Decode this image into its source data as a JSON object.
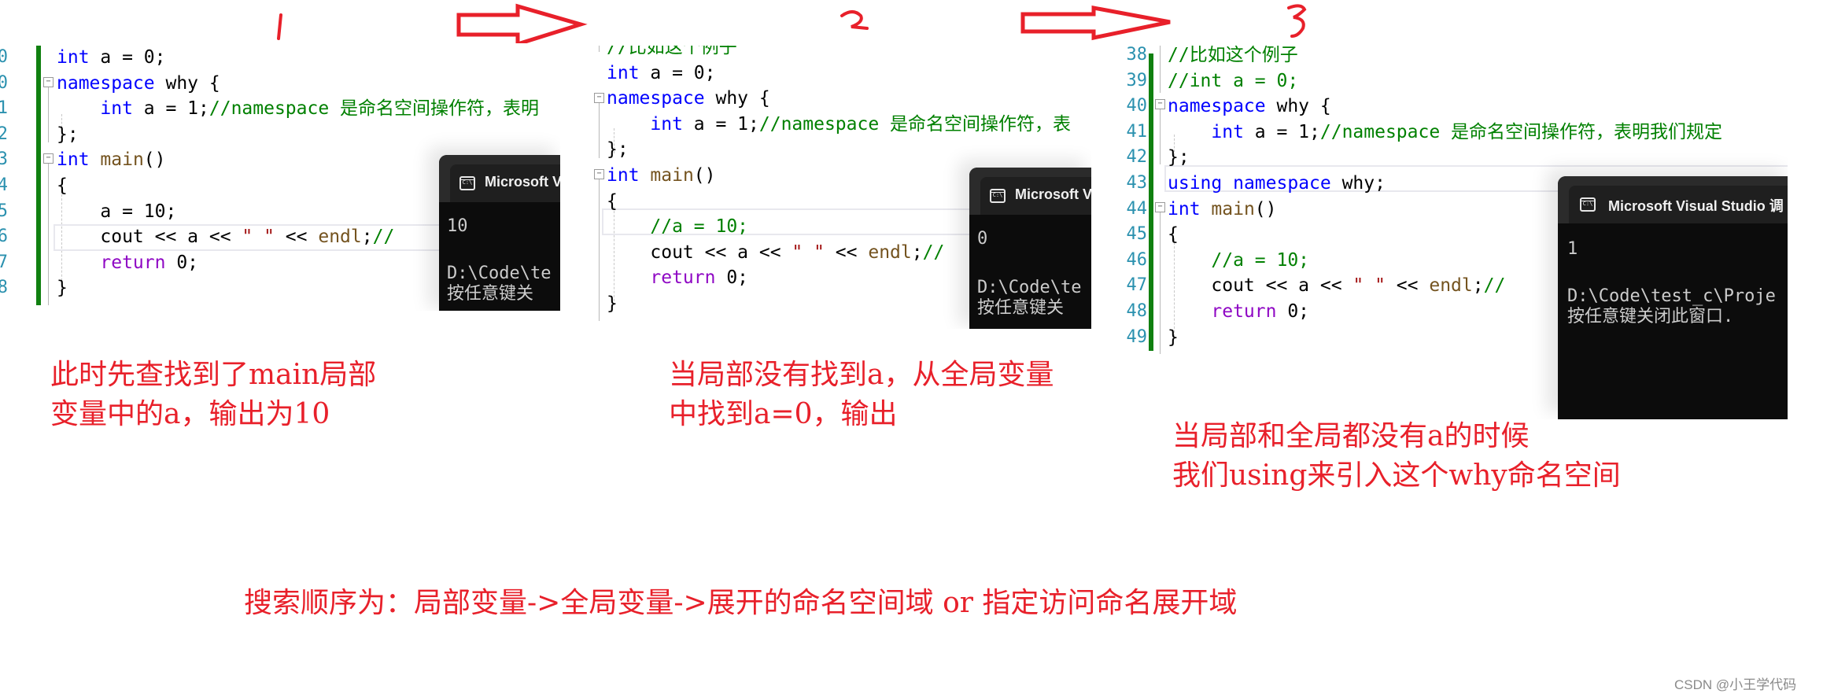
{
  "step_markers": [
    "1",
    "2",
    "3"
  ],
  "panels": [
    {
      "id": "panel-1",
      "line_numbers": [
        "0",
        "0",
        "1",
        "2",
        "3",
        "4",
        "5",
        "6",
        "7",
        "8"
      ],
      "lines": [
        [
          {
            "t": "int",
            "c": "kw"
          },
          {
            "t": " a = 0;",
            "c": "tx"
          }
        ],
        [
          {
            "t": "namespace",
            "c": "kw"
          },
          {
            "t": " why {",
            "c": "tx"
          }
        ],
        [
          {
            "t": "    ",
            "c": "tx"
          },
          {
            "t": "int",
            "c": "kw"
          },
          {
            "t": " a = 1;",
            "c": "tx"
          },
          {
            "t": "//namespace 是命名空间操作符，表明",
            "c": "cm"
          }
        ],
        [
          {
            "t": "};",
            "c": "tx"
          }
        ],
        [
          {
            "t": "int",
            "c": "kw"
          },
          {
            "t": " ",
            "c": "tx"
          },
          {
            "t": "main",
            "c": "fn"
          },
          {
            "t": "()",
            "c": "tx"
          }
        ],
        [
          {
            "t": "{",
            "c": "tx"
          }
        ],
        [
          {
            "t": "    a = 10;",
            "c": "tx"
          }
        ],
        [
          {
            "t": "    cout << a << ",
            "c": "tx"
          },
          {
            "t": "\" \"",
            "c": "st"
          },
          {
            "t": " << ",
            "c": "tx"
          },
          {
            "t": "endl",
            "c": "fn"
          },
          {
            "t": ";",
            "c": "tx"
          },
          {
            "t": "//",
            "c": "cm"
          }
        ],
        [
          {
            "t": "    ",
            "c": "tx"
          },
          {
            "t": "return",
            "c": "kw2"
          },
          {
            "t": " 0;",
            "c": "tx"
          }
        ],
        [
          {
            "t": "}",
            "c": "tx"
          }
        ]
      ],
      "console": {
        "title": "Microsoft V",
        "icon": "console-window-icon",
        "output": "10",
        "path": "D:\\Code\\te",
        "prompt": "按任意键关"
      },
      "caption": [
        "此时先查找到了main局部",
        "变量中的a，输出为10"
      ]
    },
    {
      "id": "panel-2",
      "lines": [
        [
          {
            "t": "//比如这个例子",
            "c": "cm"
          }
        ],
        [
          {
            "t": "int",
            "c": "kw"
          },
          {
            "t": " a = 0;",
            "c": "tx"
          }
        ],
        [
          {
            "t": "namespace",
            "c": "kw"
          },
          {
            "t": " why {",
            "c": "tx"
          }
        ],
        [
          {
            "t": "    ",
            "c": "tx"
          },
          {
            "t": "int",
            "c": "kw"
          },
          {
            "t": " a = 1;",
            "c": "tx"
          },
          {
            "t": "//namespace 是命名空间操作符，表",
            "c": "cm"
          }
        ],
        [
          {
            "t": "};",
            "c": "tx"
          }
        ],
        [
          {
            "t": "int",
            "c": "kw"
          },
          {
            "t": " ",
            "c": "tx"
          },
          {
            "t": "main",
            "c": "fn"
          },
          {
            "t": "()",
            "c": "tx"
          }
        ],
        [
          {
            "t": "{",
            "c": "tx"
          }
        ],
        [
          {
            "t": "    ",
            "c": "tx"
          },
          {
            "t": "//a = 10;",
            "c": "cm"
          }
        ],
        [
          {
            "t": "    cout << a << ",
            "c": "tx"
          },
          {
            "t": "\" \"",
            "c": "st"
          },
          {
            "t": " << ",
            "c": "tx"
          },
          {
            "t": "endl",
            "c": "fn"
          },
          {
            "t": ";",
            "c": "tx"
          },
          {
            "t": "//",
            "c": "cm"
          }
        ],
        [
          {
            "t": "    ",
            "c": "tx"
          },
          {
            "t": "return",
            "c": "kw2"
          },
          {
            "t": " 0;",
            "c": "tx"
          }
        ],
        [
          {
            "t": "}",
            "c": "tx"
          }
        ]
      ],
      "console": {
        "title": "Microsoft V",
        "icon": "console-window-icon",
        "output": "0",
        "path": "D:\\Code\\te",
        "prompt": "按任意键关"
      },
      "caption": [
        "当局部没有找到a，从全局变量",
        "中找到a=0，输出"
      ]
    },
    {
      "id": "panel-3",
      "line_numbers": [
        "38",
        "39",
        "40",
        "41",
        "42",
        "43",
        "44",
        "45",
        "46",
        "47",
        "48",
        "49"
      ],
      "lines": [
        [
          {
            "t": "//比如这个例子",
            "c": "cm"
          }
        ],
        [
          {
            "t": "//int a = 0;",
            "c": "cm"
          }
        ],
        [
          {
            "t": "namespace",
            "c": "kw"
          },
          {
            "t": " why {",
            "c": "tx"
          }
        ],
        [
          {
            "t": "    ",
            "c": "tx"
          },
          {
            "t": "int",
            "c": "kw"
          },
          {
            "t": " a = 1;",
            "c": "tx"
          },
          {
            "t": "//namespace 是命名空间操作符，表明我们规定",
            "c": "cm"
          }
        ],
        [
          {
            "t": "};",
            "c": "tx"
          }
        ],
        [
          {
            "t": "using",
            "c": "kw"
          },
          {
            "t": " ",
            "c": "tx"
          },
          {
            "t": "namespace",
            "c": "kw"
          },
          {
            "t": " why;",
            "c": "tx"
          }
        ],
        [
          {
            "t": "int",
            "c": "kw"
          },
          {
            "t": " ",
            "c": "tx"
          },
          {
            "t": "main",
            "c": "fn"
          },
          {
            "t": "()",
            "c": "tx"
          }
        ],
        [
          {
            "t": "{",
            "c": "tx"
          }
        ],
        [
          {
            "t": "    ",
            "c": "tx"
          },
          {
            "t": "//a = 10;",
            "c": "cm"
          }
        ],
        [
          {
            "t": "    cout << a << ",
            "c": "tx"
          },
          {
            "t": "\" \"",
            "c": "st"
          },
          {
            "t": " << ",
            "c": "tx"
          },
          {
            "t": "endl",
            "c": "fn"
          },
          {
            "t": ";",
            "c": "tx"
          },
          {
            "t": "//",
            "c": "cm"
          }
        ],
        [
          {
            "t": "    ",
            "c": "tx"
          },
          {
            "t": "return",
            "c": "kw2"
          },
          {
            "t": " 0;",
            "c": "tx"
          }
        ],
        [
          {
            "t": "}",
            "c": "tx"
          }
        ]
      ],
      "console": {
        "title": "Microsoft Visual Studio 调",
        "icon": "console-window-icon",
        "output": "1",
        "path": "D:\\Code\\test_c\\Proje",
        "prompt": "按任意键关闭此窗口."
      },
      "caption": [
        "当局部和全局都没有a的时候",
        "我们using来引入这个why命名空间"
      ]
    }
  ],
  "summary": "搜索顺序为：局部变量->全局变量->展开的命名空间域 or 指定访问命名展开域",
  "watermark": "CSDN @小王学代码",
  "colors": {
    "annotation_red": "#e8202a",
    "keyword_blue": "#0000ff",
    "comment_green": "#008000",
    "change_bar_green": "#108010",
    "console_bg": "#0c0c0c"
  }
}
